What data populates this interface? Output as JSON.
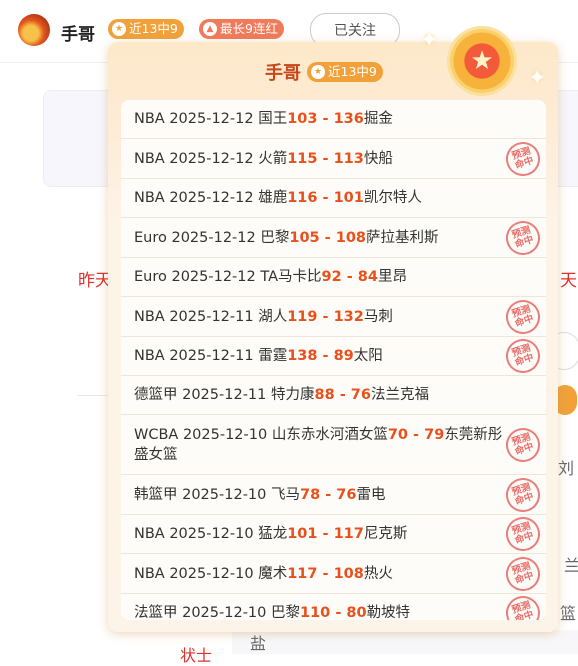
{
  "header": {
    "name": "手哥",
    "streak_badge": "近13中9",
    "red_badge": "最长9连红",
    "follow_label": "已关注"
  },
  "background": {
    "left_red": "昨天",
    "right_red": "天",
    "right_text_a": "刘",
    "right_text_b": "兰",
    "right_text_c": "篮",
    "bottom_text": "盐",
    "bottom_red": "状士"
  },
  "popup": {
    "name": "手哥",
    "badge": "近13中9",
    "stamp_line1": "预测",
    "stamp_line2": "命中",
    "games": [
      {
        "prefix": "NBA 2025-12-12 国王",
        "score": "103 - 136",
        "suffix": "掘金",
        "hit": false
      },
      {
        "prefix": "NBA 2025-12-12 火箭",
        "score": "115 - 113",
        "suffix": "快船",
        "hit": true
      },
      {
        "prefix": "NBA 2025-12-12 雄鹿",
        "score": "116 - 101",
        "suffix": "凯尔特人",
        "hit": false
      },
      {
        "prefix": "Euro 2025-12-12 巴黎",
        "score": "105 - 108",
        "suffix": "萨拉基利斯",
        "hit": true
      },
      {
        "prefix": "Euro 2025-12-12 TA马卡比",
        "score": "92 - 84",
        "suffix": "里昂",
        "hit": false
      },
      {
        "prefix": "NBA 2025-12-11 湖人",
        "score": "119 - 132",
        "suffix": "马刺",
        "hit": true
      },
      {
        "prefix": "NBA 2025-12-11 雷霆",
        "score": "138 - 89",
        "suffix": "太阳",
        "hit": true
      },
      {
        "prefix": "德篮甲 2025-12-11 特力康",
        "score": "88 - 76",
        "suffix": "法兰克福",
        "hit": false
      },
      {
        "prefix": "WCBA 2025-12-10 山东赤水河酒女篮",
        "score": "70 - 79",
        "suffix": "东莞新彤盛女篮",
        "hit": true
      },
      {
        "prefix": "韩篮甲 2025-12-10 飞马",
        "score": "78 - 76",
        "suffix": "雷电",
        "hit": true
      },
      {
        "prefix": "NBA 2025-12-10 猛龙",
        "score": "101 - 117",
        "suffix": "尼克斯",
        "hit": true
      },
      {
        "prefix": "NBA 2025-12-10 魔术",
        "score": "117 - 108",
        "suffix": "热火",
        "hit": true
      },
      {
        "prefix": "法篮甲 2025-12-10 巴黎",
        "score": "110 - 80",
        "suffix": "勒坡特",
        "hit": true
      }
    ]
  }
}
